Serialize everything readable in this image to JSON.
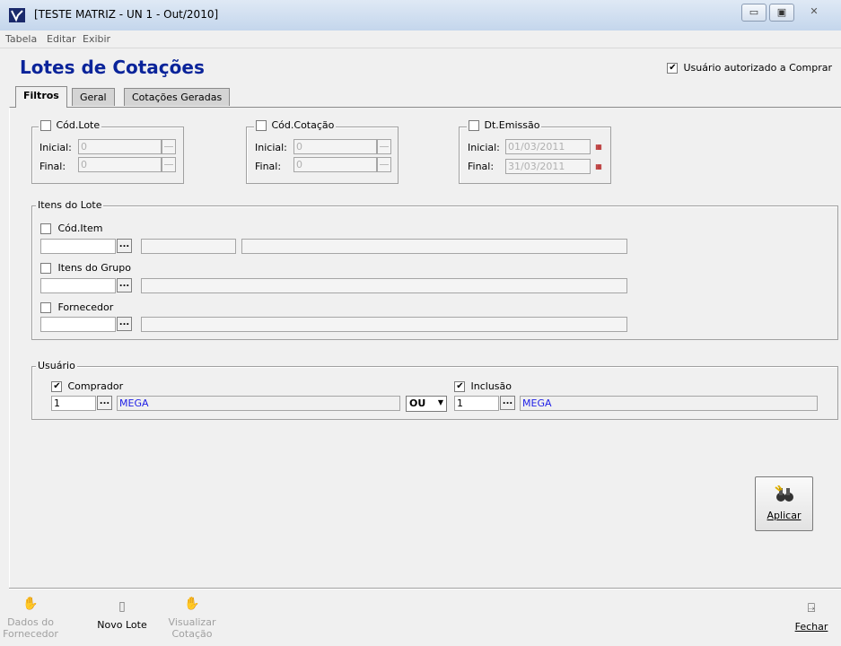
{
  "window": {
    "title": "[TESTE MATRIZ - UN 1 - Out/2010]",
    "minimize_glyph": "▭",
    "maximize_glyph": "▣",
    "close_glyph": "✕"
  },
  "menu": [
    "Tabela",
    "Editar",
    "Exibir"
  ],
  "header": {
    "title": "Lotes de Cotações",
    "authorized_label": "Usuário autorizado a Comprar",
    "authorized_checked": true
  },
  "tabs": [
    {
      "label": "Filtros",
      "active": true
    },
    {
      "label": "Geral",
      "active": false
    },
    {
      "label": "Cotações Geradas",
      "active": false
    }
  ],
  "filters": {
    "lote": {
      "label": "Cód.Lote",
      "inicial_label": "Inicial:",
      "inicial": "0",
      "final_label": "Final:",
      "final": "0"
    },
    "cotacao": {
      "label": "Cód.Cotação",
      "inicial_label": "Inicial:",
      "inicial": "0",
      "final_label": "Final:",
      "final": "0"
    },
    "emissao": {
      "label": "Dt.Emissão",
      "inicial_label": "Inicial:",
      "inicial": "01/03/2011",
      "final_label": "Final:",
      "final": "31/03/2011"
    }
  },
  "itens_lote": {
    "legend": "Itens do Lote",
    "cod_item_label": "Cód.Item",
    "grupo_label": "Itens do Grupo",
    "fornecedor_label": "Fornecedor"
  },
  "usuario": {
    "legend": "Usuário",
    "comprador_label": "Comprador",
    "comprador_code": "1",
    "comprador_name": "MEGA",
    "operator": "OU",
    "inclusao_label": "Inclusão",
    "inclusao_code": "1",
    "inclusao_name": "MEGA"
  },
  "buttons": {
    "aplicar": "Aplicar",
    "dados_fornecedor": [
      "Dados do",
      "Fornecedor"
    ],
    "novo_lote": "Novo Lote",
    "visualizar_cotacao": [
      "Visualizar",
      "Cotação"
    ],
    "fechar": "Fechar"
  },
  "colors": {
    "title_blue": "#0a249a",
    "value_blue": "#1e1ee6"
  }
}
